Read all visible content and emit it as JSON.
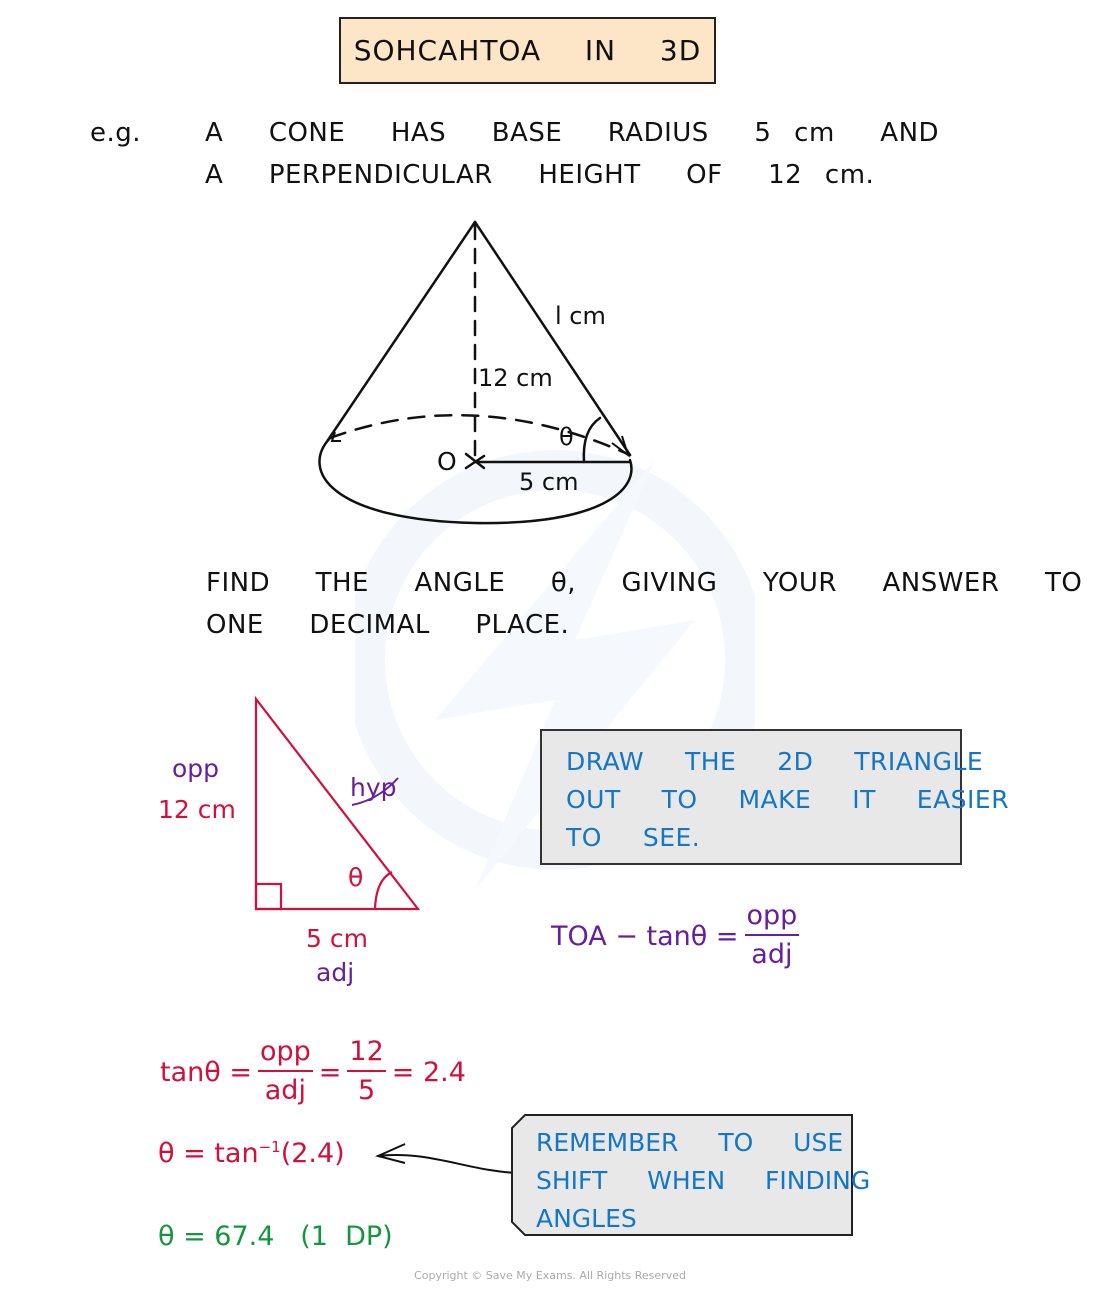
{
  "title": "SOHCAHTOA  IN  3D",
  "example_label": "e.g.",
  "question": {
    "line1": "A  CONE  HAS  BASE  RADIUS  5 cm  AND",
    "line2": "A  PERPENDICULAR  HEIGHT  OF  12 cm."
  },
  "cone_diagram": {
    "slant_label": "l cm",
    "height_label": "12 cm",
    "radius_label": "5 cm",
    "centre_label": "O",
    "angle_label": "θ"
  },
  "task": {
    "line1": "FIND  THE  ANGLE  θ,  GIVING  YOUR  ANSWER  TO",
    "line2": "ONE  DECIMAL  PLACE."
  },
  "triangle_diagram": {
    "opp_word": "opp",
    "opp_value": "12 cm",
    "hyp_word": "hyp",
    "adj_value": "5 cm",
    "adj_word": "adj",
    "angle_label": "θ"
  },
  "note_draw": {
    "lines": [
      "DRAW  THE  2D  TRIANGLE",
      "OUT  TO  MAKE  IT  EASIER",
      "TO  SEE."
    ]
  },
  "toa_formula": {
    "prefix": "TOA − tanθ =",
    "numerator": "opp",
    "denominator": "adj"
  },
  "working": {
    "step1_lhs": "tanθ =",
    "step1_num1": "opp",
    "step1_den1": "adj",
    "step1_eq2": "=",
    "step1_num2": "12",
    "step1_den2": "5",
    "step1_result": "= 2.4",
    "step2_lhs": "θ = tan",
    "step2_sup": "−1",
    "step2_arg": "(2.4)",
    "answer": "θ = 67.4",
    "answer_note": "(1  DP)"
  },
  "note_shift": {
    "lines": [
      "REMEMBER  TO  USE",
      "SHIFT  WHEN  FINDING",
      "ANGLES"
    ]
  },
  "copyright": "Copyright © Save My Exams. All Rights Reserved",
  "colors": {
    "title_bg": "#fde5c8",
    "working_red": "#d2103c",
    "label_purple": "#6a1f9a",
    "answer_green": "#14963e",
    "note_blue": "#1476c6",
    "note_bg": "#e8e8e8"
  }
}
